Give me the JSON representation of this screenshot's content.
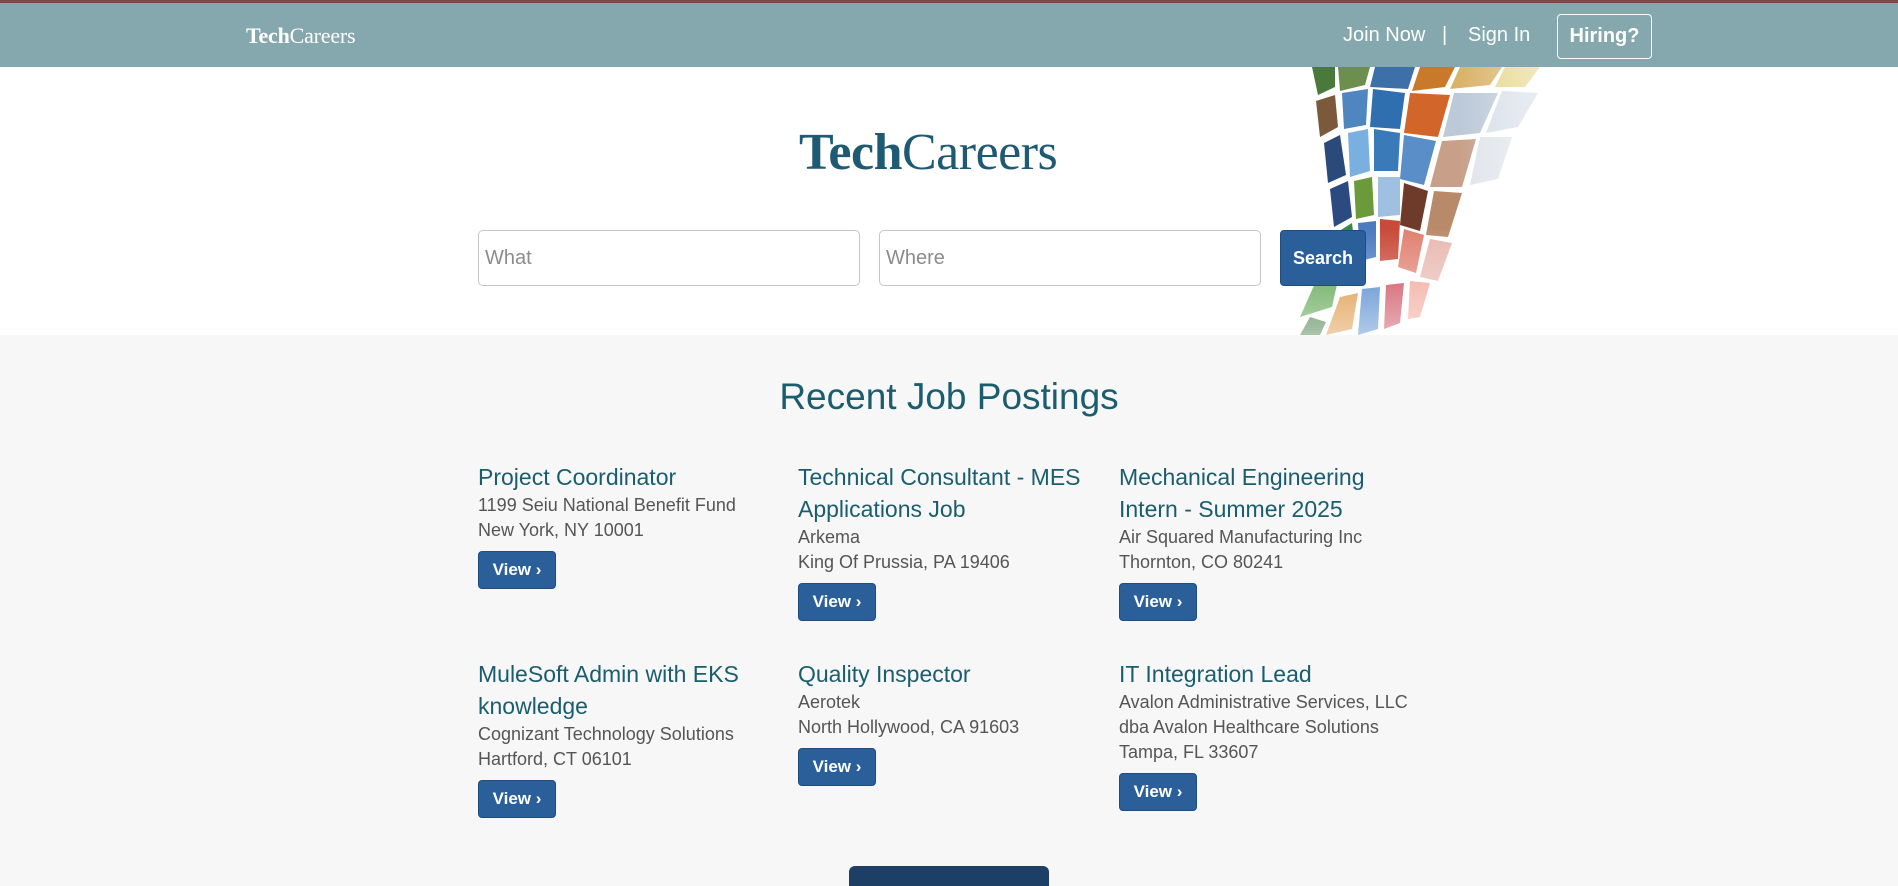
{
  "topbar": {
    "brand_part1": "Tech",
    "brand_part2": "Careers",
    "join_label": "Join Now",
    "separator": "|",
    "signin_label": "Sign In",
    "hiring_label": "Hiring?"
  },
  "hero": {
    "logo_part1": "Tech",
    "logo_part2": "Careers",
    "what_placeholder": "What",
    "where_placeholder": "Where",
    "search_label": "Search"
  },
  "section": {
    "title": "Recent Job Postings"
  },
  "jobs": [
    {
      "title": "Project Coordinator",
      "company": "1199 Seiu National Benefit Fund",
      "company2": "",
      "location": "New York, NY 10001",
      "view_label": "View ›"
    },
    {
      "title": "Technical Consultant - MES Applications Job",
      "company": "Arkema",
      "company2": "",
      "location": "King Of Prussia, PA 19406",
      "view_label": "View ›"
    },
    {
      "title": "Mechanical Engineering Intern - Summer 2025",
      "company": "Air Squared Manufacturing Inc",
      "company2": "",
      "location": "Thornton, CO 80241",
      "view_label": "View ›"
    },
    {
      "title": "MuleSoft Admin with EKS knowledge",
      "company": "Cognizant Technology Solutions",
      "company2": "",
      "location": "Hartford, CT 06101",
      "view_label": "View ›"
    },
    {
      "title": "Quality Inspector",
      "company": "Aerotek",
      "company2": "",
      "location": "North Hollywood, CA 91603",
      "view_label": "View ›"
    },
    {
      "title": "IT Integration Lead",
      "company": "Avalon Administrative Services, LLC",
      "company2": "dba Avalon Healthcare Solutions",
      "location": "Tampa, FL 33607",
      "view_label": "View ›"
    }
  ],
  "colors": {
    "topbar_bg": "#85a8ae",
    "accent_teal": "#1a5d6e",
    "button_blue": "#2a5f9a",
    "page_bg": "#f7f7f7"
  }
}
